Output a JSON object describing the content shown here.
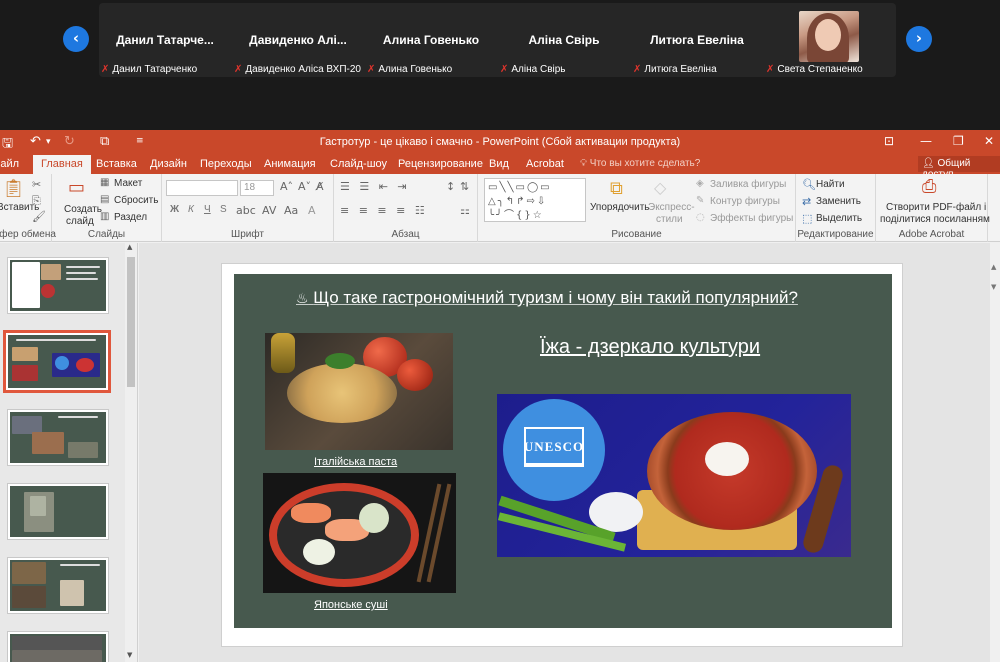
{
  "participants": {
    "tiles": [
      {
        "name": "Данил  Татарче...",
        "label": "Данил Татарченко"
      },
      {
        "name": "Давиденко  Алі...",
        "label": "Давиденко Аліса ВХП-20"
      },
      {
        "name": "Алина Говенько",
        "label": "Алина Говенько"
      },
      {
        "name": "Аліна Свірь",
        "label": "Аліна Свірь"
      },
      {
        "name": "Литюга Евеліна",
        "label": "Литюга Евеліна"
      },
      {
        "name": "",
        "label": "Света Степаненко"
      }
    ],
    "prev_icon": "chevron-left-icon",
    "next_icon": "chevron-right-icon"
  },
  "ppt": {
    "title": "Гастротур - це цікаво і смачно - PowerPoint (Сбой активации продукта)",
    "tabs": [
      "Файл",
      "Главная",
      "Вставка",
      "Дизайн",
      "Переходы",
      "Анимация",
      "Слайд-шоу",
      "Рецензирование",
      "Вид",
      "Acrobat"
    ],
    "active_tab": "Главная",
    "tell_me": "Что вы хотите сделать?",
    "share": "Общий доступ",
    "ribbon": {
      "paste": "Вставить",
      "clipboard": "Буфер обмена",
      "create_slide": "Создать",
      "create_slide2": "слайд",
      "layout": "Макет",
      "reset": "Сбросить",
      "section": "Раздел",
      "slides": "Слайды",
      "font": "Шрифт",
      "font_size": "18",
      "paragraph": "Абзац",
      "arrange": "Упорядочить",
      "express1": "Экспресс-",
      "express2": "стили",
      "fill": "Заливка фигуры",
      "outline": "Контур фигуры",
      "effects": "Эффекты фигуры",
      "drawing": "Рисование",
      "find": "Найти",
      "replace": "Заменить",
      "select": "Выделить",
      "editing": "Редактирование",
      "pdf1": "Створити PDF-файл і",
      "pdf2": "поділитися посиланням",
      "acrobat": "Adobe Acrobat",
      "bold": "Ж",
      "italic": "К",
      "underline": "Ч",
      "strike": "S"
    }
  },
  "slide": {
    "title": "Що таке гастрономічний туризм і чому він такий популярний?",
    "subtitle": "Їжа - дзеркало культури",
    "caption1": "Італійська паста",
    "caption2": "Японське суші",
    "unesco": "UNESCO"
  },
  "colors": {
    "accent": "#c9482a",
    "slide_bg": "#47594e",
    "unesco_blue": "#3f8fe0"
  }
}
